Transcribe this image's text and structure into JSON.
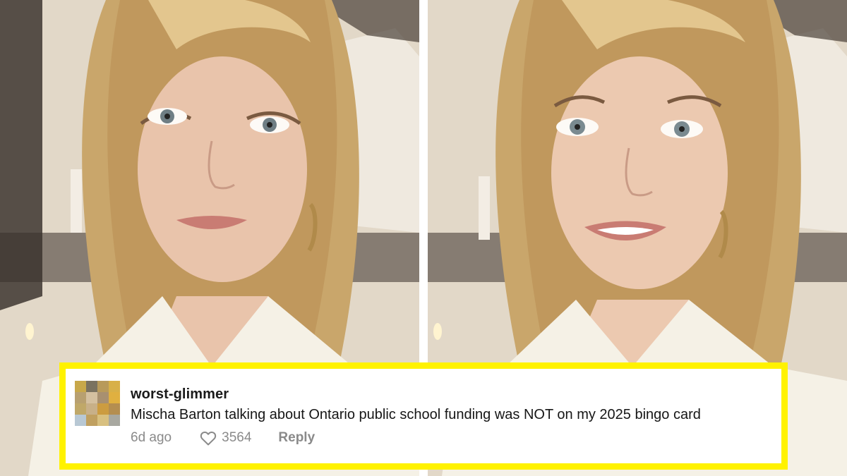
{
  "frames": [
    {
      "id": "left",
      "subject": "video-frame"
    },
    {
      "id": "right",
      "subject": "video-frame"
    }
  ],
  "comment": {
    "username": "worst-glimmer",
    "text": "Mischa Barton talking about Ontario public school funding was NOT on my 2025 bingo card",
    "time": "6d ago",
    "likes": "3564",
    "reply_label": "Reply",
    "like_icon": "heart-outline-icon",
    "avatar_style": "pixelated",
    "avatar_colors": [
      "#c8a84a",
      "#7a7260",
      "#b89a5a",
      "#d8b048",
      "#b8a070",
      "#d4c0a0",
      "#a89070",
      "#e0b040",
      "#c0a868",
      "#c8b088",
      "#cc9c40",
      "#b48e50",
      "#b8c8d4",
      "#c0a060",
      "#d8c080",
      "#a8a8a0"
    ]
  },
  "colors": {
    "highlight_border": "#fff200",
    "comment_text": "#161616",
    "meta_text": "#8a8a8a"
  }
}
